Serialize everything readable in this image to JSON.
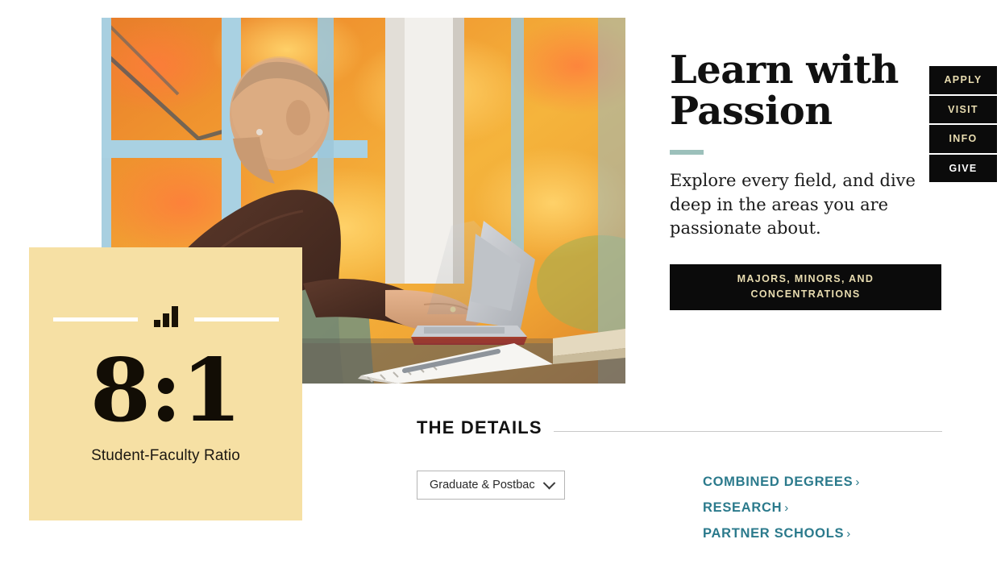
{
  "hero": {
    "title_line1": "Learn with",
    "title_line2": "Passion",
    "body": "Explore every field, and dive deep in the areas you are passionate about.",
    "cta_label": "MAJORS, MINORS, AND CONCENTRATIONS",
    "accent_color": "#9cc0bb",
    "photo": {
      "alt": "Student with shaved head in brown jacket typing on a silver laptop beside a window with autumn foliage outside",
      "icon": "student-at-laptop-photo"
    }
  },
  "side_nav": {
    "items": [
      {
        "label": "APPLY",
        "name": "side-nav-apply"
      },
      {
        "label": "VISIT",
        "name": "side-nav-visit"
      },
      {
        "label": "INFO",
        "name": "side-nav-info"
      },
      {
        "label": "GIVE",
        "name": "side-nav-give"
      }
    ],
    "background_color": "#0b0b0b",
    "text_color": "#e8dcb0"
  },
  "stat_card": {
    "value": "8:1",
    "label": "Student-Faculty Ratio",
    "background_color": "#f6e0a4",
    "icon": "bar-chart-icon"
  },
  "details": {
    "title": "THE DETAILS",
    "select": {
      "value": "Graduate & Postbac",
      "icon": "chevron-down-icon"
    },
    "links": [
      {
        "label": "COMBINED DEGREES",
        "arrow": "›",
        "name": "detail-link-combined-degrees"
      },
      {
        "label": "RESEARCH",
        "arrow": "›",
        "name": "detail-link-research"
      },
      {
        "label": "PARTNER SCHOOLS",
        "arrow": "›",
        "name": "detail-link-partner-schools"
      }
    ],
    "link_color": "#2b7a8c"
  }
}
